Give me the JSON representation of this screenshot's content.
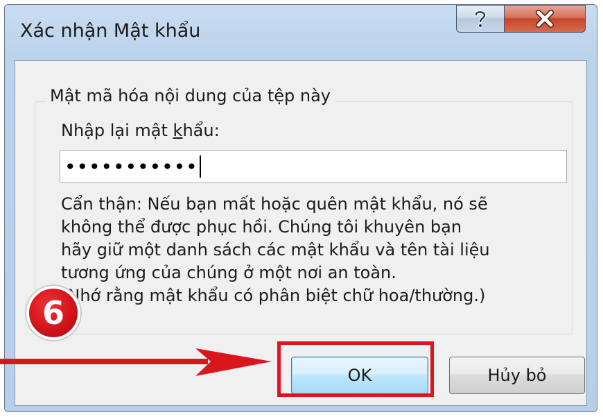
{
  "window": {
    "title": "Xác nhận Mật khẩu",
    "help_icon": "help-icon",
    "close_icon": "close-icon"
  },
  "group": {
    "legend": "Mật mã hóa nội dung của tệp này"
  },
  "field": {
    "label_before": "Nhập lại mật ",
    "label_accel": "k",
    "label_after": "hẩu:",
    "value": "•••••••••••"
  },
  "warning": {
    "lines": [
      "Cẩn thận: Nếu bạn mất hoặc quên mật khẩu, nó sẽ",
      "không thể được phục hồi. Chúng tôi khuyên bạn",
      "hãy giữ một danh sách các mật khẩu và tên tài liệu",
      "tương ứng của chúng ở một nơi an toàn.",
      "(Nhớ rằng mật khẩu có phân biệt chữ hoa/thường.)"
    ]
  },
  "buttons": {
    "ok_label": "OK",
    "cancel_label": "Hủy bỏ"
  },
  "annotation": {
    "step_number": "6",
    "highlight_color": "#e0141c",
    "arrow_icon": "arrow-right-icon"
  }
}
